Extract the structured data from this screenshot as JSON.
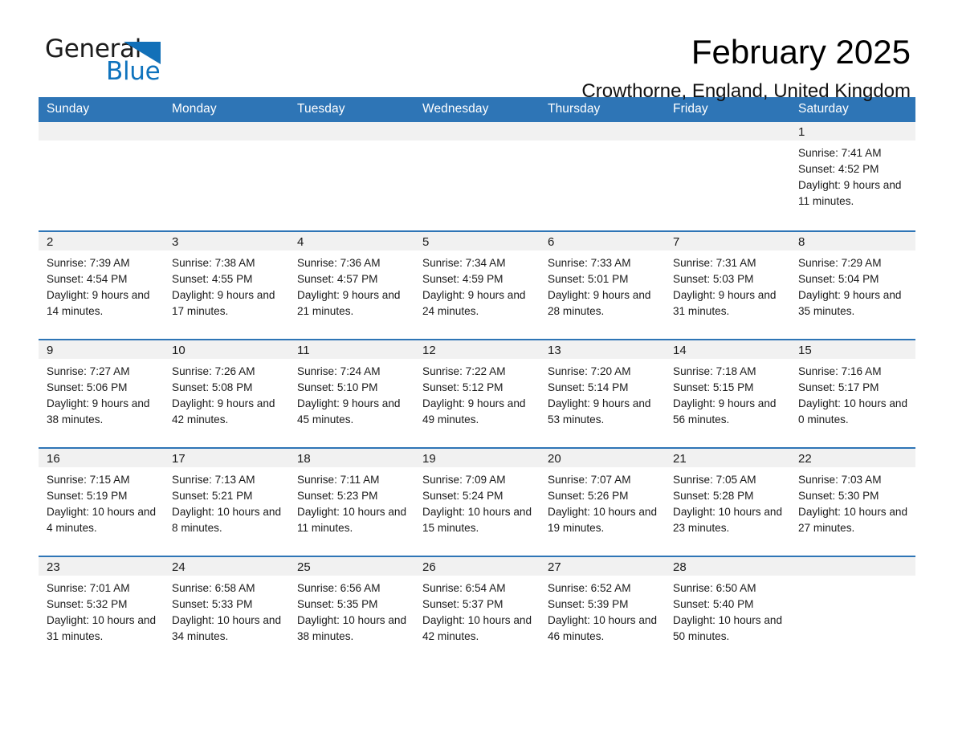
{
  "brand": {
    "name_part1": "General",
    "name_part2": "Blue",
    "logo_icon": "triangle-logo-icon",
    "accent_color": "#0f73bd"
  },
  "header": {
    "title": "February 2025",
    "subtitle": "Crowthorne, England, United Kingdom"
  },
  "theme": {
    "header_row_bg": "#2e75b6",
    "day_number_bg": "#f1f1f1",
    "cell_bg": "#ffffff",
    "text_color": "#1a1a1a"
  },
  "weekday_headers": [
    "Sunday",
    "Monday",
    "Tuesday",
    "Wednesday",
    "Thursday",
    "Friday",
    "Saturday"
  ],
  "labels": {
    "sunrise_prefix": "Sunrise:",
    "sunset_prefix": "Sunset:",
    "daylight_prefix": "Daylight:"
  },
  "weeks": [
    [
      {
        "day": "",
        "blank": true
      },
      {
        "day": "",
        "blank": true
      },
      {
        "day": "",
        "blank": true
      },
      {
        "day": "",
        "blank": true
      },
      {
        "day": "",
        "blank": true
      },
      {
        "day": "",
        "blank": true
      },
      {
        "day": "1",
        "sunrise": "Sunrise: 7:41 AM",
        "sunset": "Sunset: 4:52 PM",
        "daylight": "Daylight: 9 hours and 11 minutes."
      }
    ],
    [
      {
        "day": "2",
        "sunrise": "Sunrise: 7:39 AM",
        "sunset": "Sunset: 4:54 PM",
        "daylight": "Daylight: 9 hours and 14 minutes."
      },
      {
        "day": "3",
        "sunrise": "Sunrise: 7:38 AM",
        "sunset": "Sunset: 4:55 PM",
        "daylight": "Daylight: 9 hours and 17 minutes."
      },
      {
        "day": "4",
        "sunrise": "Sunrise: 7:36 AM",
        "sunset": "Sunset: 4:57 PM",
        "daylight": "Daylight: 9 hours and 21 minutes."
      },
      {
        "day": "5",
        "sunrise": "Sunrise: 7:34 AM",
        "sunset": "Sunset: 4:59 PM",
        "daylight": "Daylight: 9 hours and 24 minutes."
      },
      {
        "day": "6",
        "sunrise": "Sunrise: 7:33 AM",
        "sunset": "Sunset: 5:01 PM",
        "daylight": "Daylight: 9 hours and 28 minutes."
      },
      {
        "day": "7",
        "sunrise": "Sunrise: 7:31 AM",
        "sunset": "Sunset: 5:03 PM",
        "daylight": "Daylight: 9 hours and 31 minutes."
      },
      {
        "day": "8",
        "sunrise": "Sunrise: 7:29 AM",
        "sunset": "Sunset: 5:04 PM",
        "daylight": "Daylight: 9 hours and 35 minutes."
      }
    ],
    [
      {
        "day": "9",
        "sunrise": "Sunrise: 7:27 AM",
        "sunset": "Sunset: 5:06 PM",
        "daylight": "Daylight: 9 hours and 38 minutes."
      },
      {
        "day": "10",
        "sunrise": "Sunrise: 7:26 AM",
        "sunset": "Sunset: 5:08 PM",
        "daylight": "Daylight: 9 hours and 42 minutes."
      },
      {
        "day": "11",
        "sunrise": "Sunrise: 7:24 AM",
        "sunset": "Sunset: 5:10 PM",
        "daylight": "Daylight: 9 hours and 45 minutes."
      },
      {
        "day": "12",
        "sunrise": "Sunrise: 7:22 AM",
        "sunset": "Sunset: 5:12 PM",
        "daylight": "Daylight: 9 hours and 49 minutes."
      },
      {
        "day": "13",
        "sunrise": "Sunrise: 7:20 AM",
        "sunset": "Sunset: 5:14 PM",
        "daylight": "Daylight: 9 hours and 53 minutes."
      },
      {
        "day": "14",
        "sunrise": "Sunrise: 7:18 AM",
        "sunset": "Sunset: 5:15 PM",
        "daylight": "Daylight: 9 hours and 56 minutes."
      },
      {
        "day": "15",
        "sunrise": "Sunrise: 7:16 AM",
        "sunset": "Sunset: 5:17 PM",
        "daylight": "Daylight: 10 hours and 0 minutes."
      }
    ],
    [
      {
        "day": "16",
        "sunrise": "Sunrise: 7:15 AM",
        "sunset": "Sunset: 5:19 PM",
        "daylight": "Daylight: 10 hours and 4 minutes."
      },
      {
        "day": "17",
        "sunrise": "Sunrise: 7:13 AM",
        "sunset": "Sunset: 5:21 PM",
        "daylight": "Daylight: 10 hours and 8 minutes."
      },
      {
        "day": "18",
        "sunrise": "Sunrise: 7:11 AM",
        "sunset": "Sunset: 5:23 PM",
        "daylight": "Daylight: 10 hours and 11 minutes."
      },
      {
        "day": "19",
        "sunrise": "Sunrise: 7:09 AM",
        "sunset": "Sunset: 5:24 PM",
        "daylight": "Daylight: 10 hours and 15 minutes."
      },
      {
        "day": "20",
        "sunrise": "Sunrise: 7:07 AM",
        "sunset": "Sunset: 5:26 PM",
        "daylight": "Daylight: 10 hours and 19 minutes."
      },
      {
        "day": "21",
        "sunrise": "Sunrise: 7:05 AM",
        "sunset": "Sunset: 5:28 PM",
        "daylight": "Daylight: 10 hours and 23 minutes."
      },
      {
        "day": "22",
        "sunrise": "Sunrise: 7:03 AM",
        "sunset": "Sunset: 5:30 PM",
        "daylight": "Daylight: 10 hours and 27 minutes."
      }
    ],
    [
      {
        "day": "23",
        "sunrise": "Sunrise: 7:01 AM",
        "sunset": "Sunset: 5:32 PM",
        "daylight": "Daylight: 10 hours and 31 minutes."
      },
      {
        "day": "24",
        "sunrise": "Sunrise: 6:58 AM",
        "sunset": "Sunset: 5:33 PM",
        "daylight": "Daylight: 10 hours and 34 minutes."
      },
      {
        "day": "25",
        "sunrise": "Sunrise: 6:56 AM",
        "sunset": "Sunset: 5:35 PM",
        "daylight": "Daylight: 10 hours and 38 minutes."
      },
      {
        "day": "26",
        "sunrise": "Sunrise: 6:54 AM",
        "sunset": "Sunset: 5:37 PM",
        "daylight": "Daylight: 10 hours and 42 minutes."
      },
      {
        "day": "27",
        "sunrise": "Sunrise: 6:52 AM",
        "sunset": "Sunset: 5:39 PM",
        "daylight": "Daylight: 10 hours and 46 minutes."
      },
      {
        "day": "28",
        "sunrise": "Sunrise: 6:50 AM",
        "sunset": "Sunset: 5:40 PM",
        "daylight": "Daylight: 10 hours and 50 minutes."
      },
      {
        "day": "",
        "blank": true
      }
    ]
  ]
}
